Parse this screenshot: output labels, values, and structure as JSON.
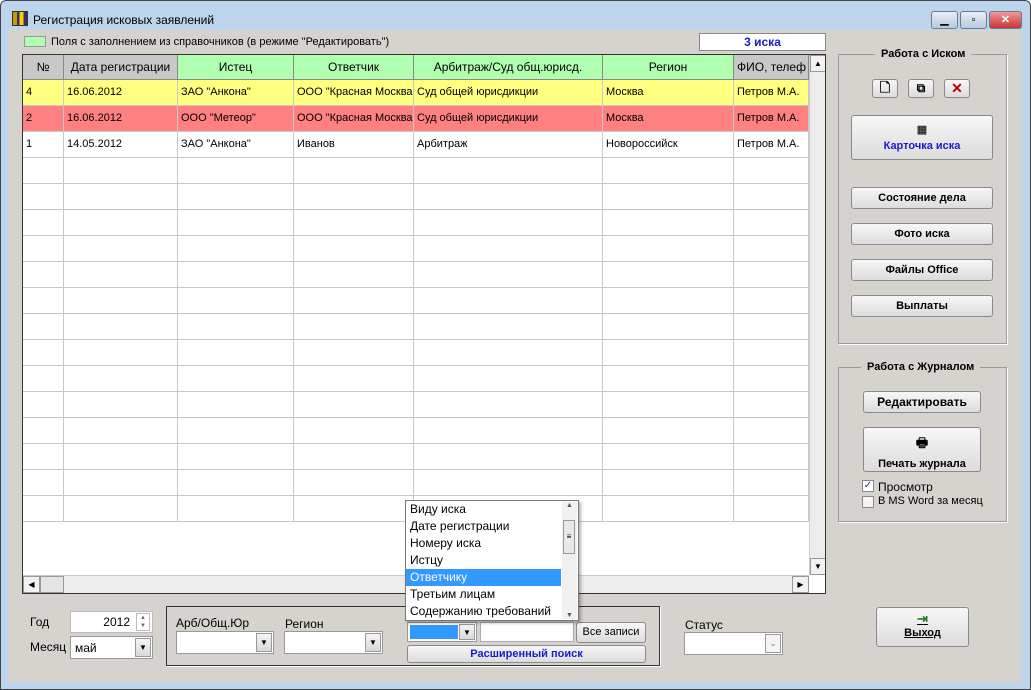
{
  "window": {
    "title": "Регистрация исковых заявлений",
    "min": "▁",
    "max": "▫",
    "close": "✕"
  },
  "legend_text": "Поля с заполнением из справочников (в режиме \"Редактировать\")",
  "count_badge": "3 иска",
  "colors": {
    "yellow_row": "#ffff80",
    "red_row": "#ff8080",
    "green_header": "#b0ffb0",
    "badge_text": "#1a1ad0"
  },
  "table": {
    "columns": [
      "№",
      "Дата регистрации",
      "Истец",
      "Ответчик",
      "Арбитраж/Суд общ.юрисд.",
      "Регион",
      "ФИО, телеф"
    ],
    "rows": [
      [
        "4",
        "16.06.2012",
        "ЗАО \"Анкона\"",
        "ООО \"Красная Москва\"",
        "Суд общей юрисдикции",
        "Москва",
        "Петров М.А."
      ],
      [
        "2",
        "16.06.2012",
        "ООО \"Метеор\"",
        "ООО \"Красная Москва\"",
        "Суд общей юрисдикции",
        "Москва",
        "Петров М.А."
      ],
      [
        "1",
        "14.05.2012",
        "ЗАО \"Анкона\"",
        "Иванов",
        "Арбитраж",
        "Новороссийск",
        "Петров М.А."
      ]
    ]
  },
  "claim_panel": {
    "title": "Работа с Иском",
    "card": "Карточка иска",
    "status": "Состояние дела",
    "photo": "Фото иска",
    "office": "Файлы Office",
    "payments": "Выплаты"
  },
  "journal_panel": {
    "title": "Работа с Журналом",
    "edit": "Редактировать",
    "print": "Печать журнала",
    "preview": "Просмотр",
    "preview_checked": true,
    "word": "В MS Word за месяц",
    "word_checked": false
  },
  "exit": "Выход",
  "filters": {
    "year_label": "Год",
    "year": "2012",
    "month_label": "Месяц",
    "month": "май",
    "arb_label": "Арб/Общ.Юр",
    "region_label": "Регион",
    "status_label": "Статус",
    "all_records": "Все записи",
    "adv_search": "Расширенный поиск"
  },
  "search_dropdown": {
    "items": [
      "Виду иска",
      "Дате регистрации",
      "Номеру иска",
      "Истцу",
      "Ответчику",
      "Третьим лицам",
      "Содержанию требований"
    ],
    "selected": "Ответчику"
  }
}
